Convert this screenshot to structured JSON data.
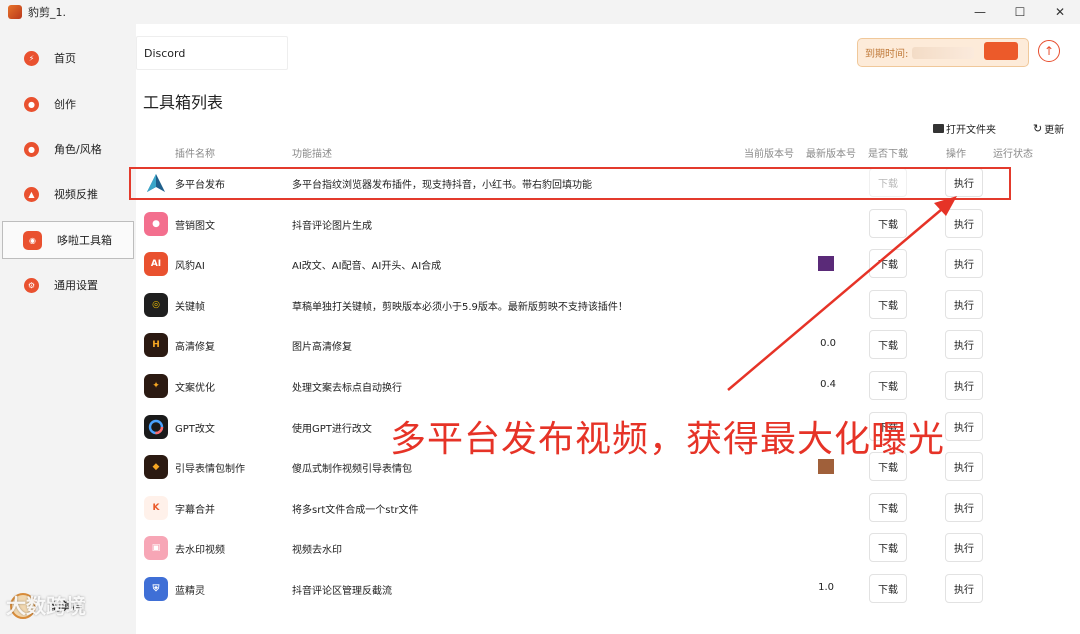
{
  "window": {
    "title": "豹剪_1.",
    "controls": [
      "—",
      "☐",
      "✕"
    ]
  },
  "sidebar": {
    "items": [
      {
        "label": "首页",
        "icon": "bolt-icon"
      },
      {
        "label": "创作",
        "icon": "palette-icon"
      },
      {
        "label": "角色/风格",
        "icon": "user-icon"
      },
      {
        "label": "视频反推",
        "icon": "video-reverse-icon"
      },
      {
        "label": "哆啦工具箱",
        "icon": "toolbox-icon",
        "active": true
      },
      {
        "label": "通用设置",
        "icon": "settings-icon"
      }
    ],
    "footer_label": "豹剪AI"
  },
  "header": {
    "tab_label": "Discord",
    "expire_label": "到期时间: ",
    "upload_icon": "upload-circle-icon"
  },
  "toolbox": {
    "title": "工具箱列表",
    "open_folder": "打开文件夹",
    "refresh": "更新",
    "columns": [
      "插件名称",
      "功能描述",
      "当前版本号",
      "最新版本号",
      "是否下载",
      "操作",
      "运行状态"
    ],
    "rows": [
      {
        "name": "多平台发布",
        "desc": "多平台指纹浏览器发布插件，现支持抖音，小红书。带右豹回填功能",
        "ver": "",
        "latest": "",
        "download": "下载",
        "download_disabled": true,
        "run": "执行",
        "icon_color": "#ffffff"
      },
      {
        "name": "营销图文",
        "desc": "抖音评论图片生成",
        "ver": "",
        "latest": "",
        "download": "下载",
        "run": "执行",
        "icon_color": "#f36f8e"
      },
      {
        "name": "风豹AI",
        "desc": "AI改文、AI配音、AI开头、AI合成",
        "ver": "",
        "latest": "",
        "download": "下载",
        "run": "执行",
        "icon_color": "#e9512f"
      },
      {
        "name": "关键帧",
        "desc": "草稿单独打关键帧，剪映版本必须小于5.9版本。最新版剪映不支持该插件！",
        "ver": "",
        "latest": "",
        "download": "下载",
        "run": "执行",
        "icon_color": "#1f1f1f"
      },
      {
        "name": "高清修复",
        "desc": "图片高清修复",
        "ver": "",
        "latest": "0.0",
        "download": "下载",
        "run": "执行",
        "icon_color": "#2b1a12"
      },
      {
        "name": "文案优化",
        "desc": "处理文案去标点自动换行",
        "ver": "",
        "latest": "0.4",
        "download": "下载",
        "run": "执行",
        "icon_color": "#2b1a12"
      },
      {
        "name": "GPT改文",
        "desc": "使用GPT进行改文",
        "ver": "",
        "latest": "",
        "download": "下载",
        "run": "执行",
        "icon_color": "#1a1a1a"
      },
      {
        "name": "引导表情包制作",
        "desc": "傻瓜式制作视频引导表情包",
        "ver": "",
        "latest": "",
        "download": "下载",
        "run": "执行",
        "icon_color": "#2b1a12"
      },
      {
        "name": "字幕合并",
        "desc": "将多srt文件合成一个str文件",
        "ver": "",
        "latest": "",
        "download": "下载",
        "run": "执行",
        "icon_color": "#fff1ea"
      },
      {
        "name": "去水印视频",
        "desc": "视频去水印",
        "ver": "",
        "latest": "",
        "download": "下载",
        "run": "执行",
        "icon_color": "#f7a6b6"
      },
      {
        "name": "蓝精灵",
        "desc": "抖音评论区管理反截流",
        "ver": "1.0",
        "latest": "",
        "download": "下载",
        "run": "执行",
        "icon_color": "#3f6fd6"
      }
    ]
  },
  "annotation": {
    "text": "多平台发布视频，获得最大化曝光",
    "color": "#e63327"
  },
  "watermark": "大数跨境"
}
